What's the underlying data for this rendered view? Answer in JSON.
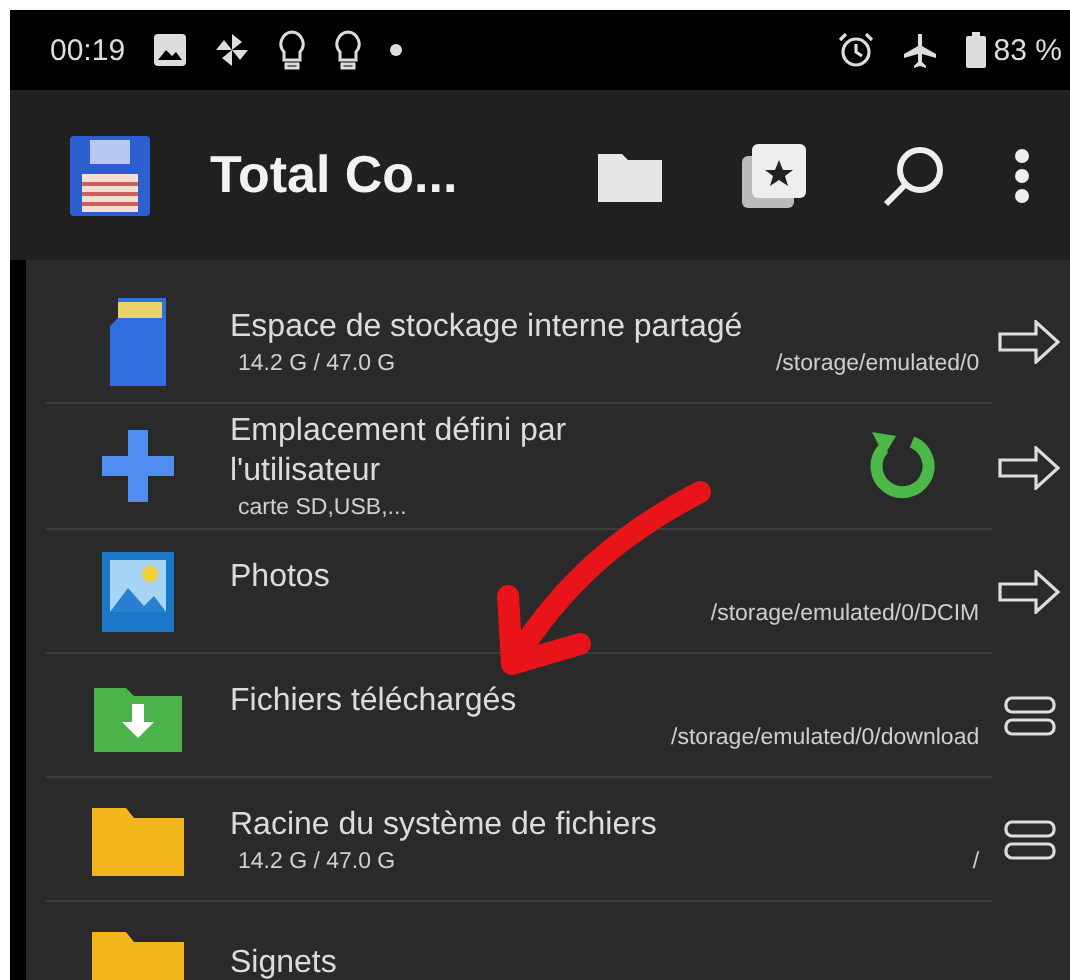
{
  "status_bar": {
    "time": "00:19",
    "battery": "83 %"
  },
  "toolbar": {
    "title": "Total Co..."
  },
  "locations": [
    {
      "title": "Espace de stockage interne partagé",
      "size": "14.2 G / 47.0 G",
      "path": "/storage/emulated/0",
      "kind": "arrow",
      "refresh": false
    },
    {
      "title": "Emplacement défini par l'utilisateur",
      "size": "carte SD,USB,...",
      "kind": "arrow",
      "refresh": true
    },
    {
      "title": "Photos",
      "path": "/storage/emulated/0/DCIM",
      "kind": "arrow",
      "refresh": false
    },
    {
      "title": "Fichiers téléchargés",
      "path": "/storage/emulated/0/download",
      "kind": "menu",
      "refresh": false
    },
    {
      "title": "Racine du système de fichiers",
      "size": "14.2 G / 47.0 G",
      "path": "/",
      "kind": "menu",
      "refresh": false
    },
    {
      "title": "Signets",
      "refresh": false
    }
  ]
}
